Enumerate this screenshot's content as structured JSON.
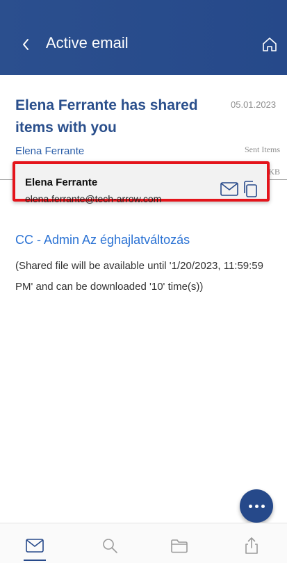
{
  "header": {
    "title": "Active email",
    "back_icon": "chevron-left-icon",
    "home_icon": "home-icon",
    "background": "#26498a"
  },
  "email": {
    "subject": "Elena Ferrante has shared items with you",
    "date": "05.01.2023",
    "sender": "Elena Ferrante",
    "folder": "Sent Items",
    "size": "KB",
    "cc": "CC - Admin Az éghajlatváltozás",
    "body": "(Shared file will be available until '1/20/2023, 11:59:59 PM' and can be downloaded '10' time(s))"
  },
  "contact_card": {
    "name": "Elena Ferrante",
    "email": "elena.ferrante@tech-arrow.com",
    "mail_icon": "mail-icon",
    "copy_icon": "copy-icon",
    "highlight_color": "#e4141b"
  },
  "fab": {
    "icon": "more-icon"
  },
  "bottom_nav": {
    "items": [
      {
        "icon": "mail-icon",
        "active": true
      },
      {
        "icon": "search-icon",
        "active": false
      },
      {
        "icon": "folder-icon",
        "active": false
      },
      {
        "icon": "share-icon",
        "active": false
      }
    ]
  }
}
